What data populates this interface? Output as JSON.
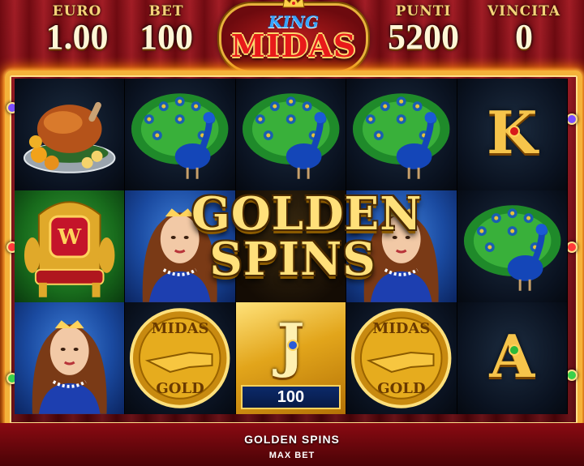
{
  "hud": {
    "euro": {
      "label": "EURO",
      "value": "1.00"
    },
    "bet": {
      "label": "BET",
      "value": "100"
    },
    "punti": {
      "label": "PUNTI",
      "value": "5200"
    },
    "vincita": {
      "label": "VINCITA",
      "value": "0"
    }
  },
  "logo": {
    "top": "KING",
    "main": "MIDAS"
  },
  "reels": [
    [
      "turkey-platter",
      "peacock",
      "peacock",
      "peacock",
      "K"
    ],
    [
      "throne",
      "queen",
      "",
      "queen",
      "peacock"
    ],
    [
      "queen",
      "midas-gold-coin",
      "J",
      "midas-gold-coin",
      "A"
    ]
  ],
  "coin": {
    "top": "MIDAS",
    "bottom": "GOLD"
  },
  "symbol_value": "100",
  "overlay": {
    "line1": "GOLDEN",
    "line2": "SPINS"
  },
  "status": {
    "message": "GOLDEN SPINS",
    "max_bet": "MAX BET"
  },
  "colors": {
    "frame": "#f4b23a",
    "hud_label": "#f4d27a",
    "curtain": "#8a0a12"
  }
}
